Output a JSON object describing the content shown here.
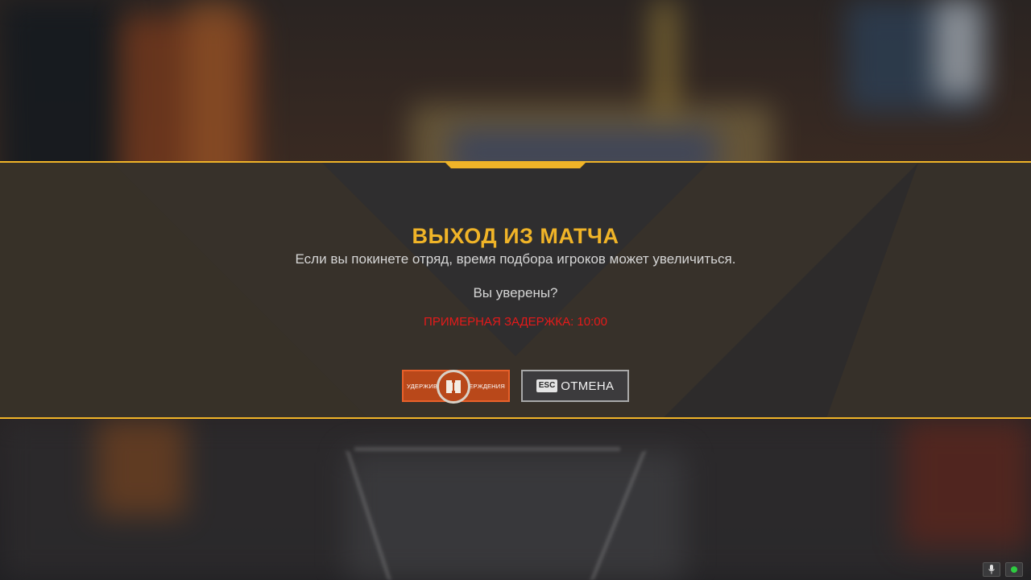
{
  "dialog": {
    "title": "ВЫХОД ИЗ МАТЧА",
    "message": "Если вы покинете отряд, время подбора игроков может увеличиться.",
    "question": "Вы уверены?",
    "delay_text": "ПРИМЕРНАЯ ЗАДЕРЖКА: 10:00"
  },
  "buttons": {
    "confirm_left_text": "УДЕРЖИВА",
    "confirm_right_text": "ВЕРЖДЕНИЯ",
    "confirm_icon": "leave-door-icon",
    "cancel_key": "ESC",
    "cancel_label": "ОТМЕНА"
  },
  "corner_icons": [
    {
      "icon": "microphone-icon"
    },
    {
      "icon": "connection-status-icon",
      "color": "#2ecc40"
    }
  ],
  "colors": {
    "accent": "#f0b428",
    "delay": "#e61a1a",
    "confirm": "#b9481a"
  }
}
